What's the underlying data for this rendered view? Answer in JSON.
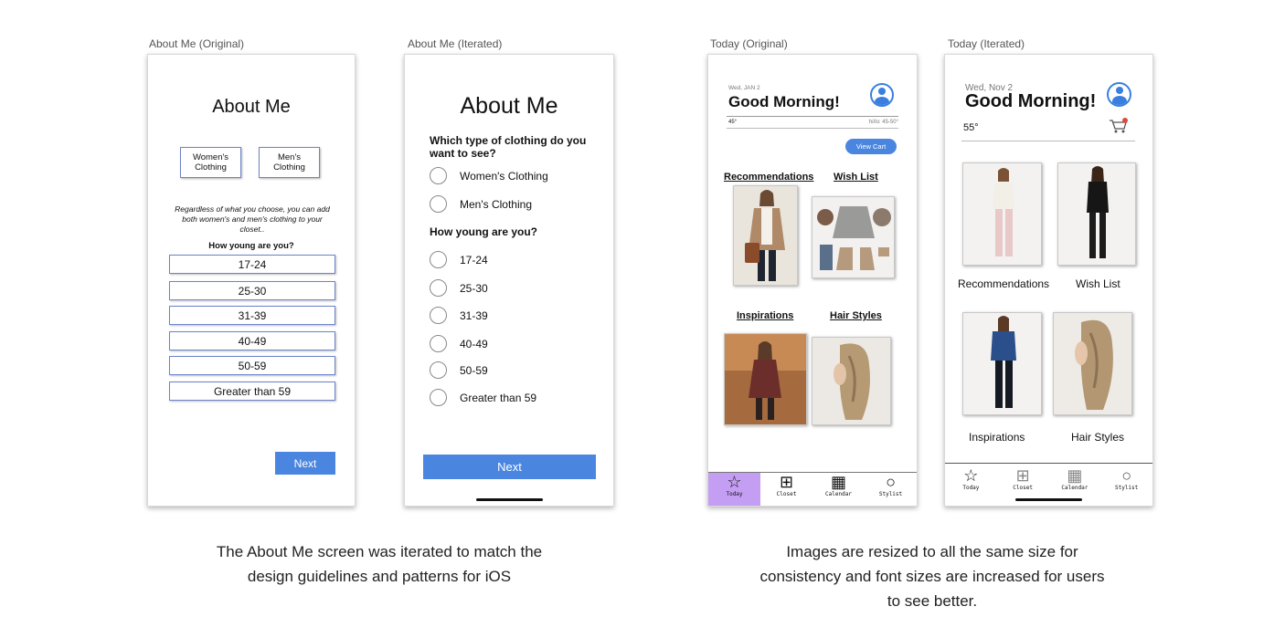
{
  "frames": {
    "about_original": "About Me (Original)",
    "about_iterated": "About Me (Iterated)",
    "today_original": "Today (Original)",
    "today_iterated": "Today (Iterated)"
  },
  "about_original": {
    "title": "About Me",
    "gender_options": [
      "Women's Clothing",
      "Men's Clothing"
    ],
    "note": "Regardless of what you choose, you can add both women's and men's clothing to your closet..",
    "age_question": "How young are you?",
    "age_options": [
      "17-24",
      "25-30",
      "31-39",
      "40-49",
      "50-59",
      "Greater than 59"
    ],
    "next_label": "Next"
  },
  "about_iterated": {
    "title": "About Me",
    "clothing_question": "Which type of clothing do you want to see?",
    "clothing_options": [
      "Women's Clothing",
      "Men's Clothing"
    ],
    "age_question": "How young are you?",
    "age_options": [
      "17-24",
      "25-30",
      "31-39",
      "40-49",
      "50-59",
      "Greater than 59"
    ],
    "next_label": "Next"
  },
  "today_original": {
    "date": "Wed, JAN 2",
    "greeting": "Good Morning!",
    "temperature": "45°",
    "hi_lo": "hi/lo: 45-50°",
    "view_cart": "View Cart",
    "sections": [
      "Recommendations",
      "Wish List",
      "Inspirations",
      "Hair Styles"
    ],
    "tabs": [
      "Today",
      "Closet",
      "Calendar",
      "Stylist"
    ]
  },
  "today_iterated": {
    "date": "Wed, Nov 2",
    "greeting": "Good Morning!",
    "temperature": "55°",
    "sections": [
      "Recommendations",
      "Wish List",
      "Inspirations",
      "Hair Styles"
    ],
    "tabs": [
      "Today",
      "Closet",
      "Calendar",
      "Stylist"
    ]
  },
  "captions": {
    "about": [
      "The About Me screen was iterated to match the",
      "design guidelines and patterns for iOS"
    ],
    "today": [
      "Images are resized to all the same size for",
      "consistency and font sizes are increased for users",
      "to see better."
    ]
  },
  "colors": {
    "accent_blue": "#4a86e0",
    "active_tab": "#c49ef2",
    "cart_badge": "#e04a3a"
  }
}
